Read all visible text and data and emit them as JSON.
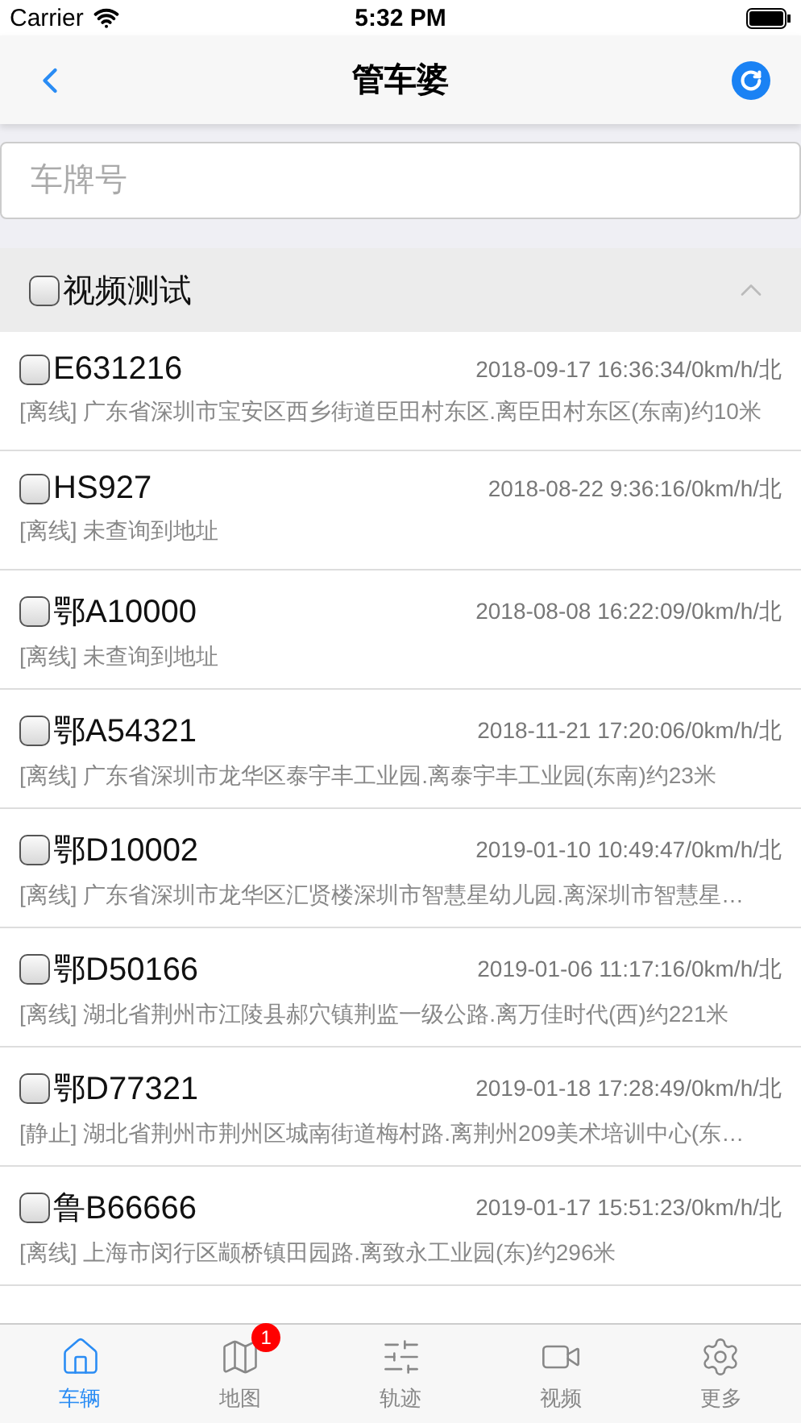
{
  "status_bar": {
    "carrier": "Carrier",
    "time": "5:32 PM"
  },
  "nav": {
    "title": "管车婆"
  },
  "search": {
    "placeholder": "车牌号"
  },
  "group": {
    "name": "视频测试",
    "checked": false,
    "expanded": true
  },
  "vehicles": [
    {
      "plate": "E631216",
      "checked": false,
      "time": "2018-09-17 16:36:34/0km/h/北",
      "address": "[离线] 广东省深圳市宝安区西乡街道臣田村东区.离臣田村东区(东南)约10米"
    },
    {
      "plate": "HS927",
      "checked": false,
      "time": "2018-08-22 9:36:16/0km/h/北",
      "address": "[离线] 未查询到地址"
    },
    {
      "plate": "鄂A10000",
      "checked": false,
      "time": "2018-08-08 16:22:09/0km/h/北",
      "address": "[离线] 未查询到地址"
    },
    {
      "plate": "鄂A54321",
      "checked": false,
      "time": "2018-11-21 17:20:06/0km/h/北",
      "address": "[离线] 广东省深圳市龙华区泰宇丰工业园.离泰宇丰工业园(东南)约23米"
    },
    {
      "plate": "鄂D10002",
      "checked": false,
      "time": "2019-01-10 10:49:47/0km/h/北",
      "address": "[离线] 广东省深圳市龙华区汇贤楼深圳市智慧星幼儿园.离深圳市智慧星…"
    },
    {
      "plate": "鄂D50166",
      "checked": false,
      "time": "2019-01-06 11:17:16/0km/h/北",
      "address": "[离线] 湖北省荆州市江陵县郝穴镇荆监一级公路.离万佳时代(西)约221米"
    },
    {
      "plate": "鄂D77321",
      "checked": false,
      "time": "2019-01-18 17:28:49/0km/h/北",
      "address": "[静止] 湖北省荆州市荆州区城南街道梅村路.离荆州209美术培训中心(东…"
    },
    {
      "plate": "鲁B66666",
      "checked": false,
      "time": "2019-01-17 15:51:23/0km/h/北",
      "address": "[离线] 上海市闵行区颛桥镇田园路.离致永工业园(东)约296米"
    }
  ],
  "tabs": [
    {
      "kind": "home",
      "label": "车辆",
      "selected": true
    },
    {
      "kind": "map",
      "label": "地图",
      "selected": false,
      "badge": "1"
    },
    {
      "kind": "track",
      "label": "轨迹",
      "selected": false
    },
    {
      "kind": "video",
      "label": "视频",
      "selected": false
    },
    {
      "kind": "more",
      "label": "更多",
      "selected": false
    }
  ]
}
